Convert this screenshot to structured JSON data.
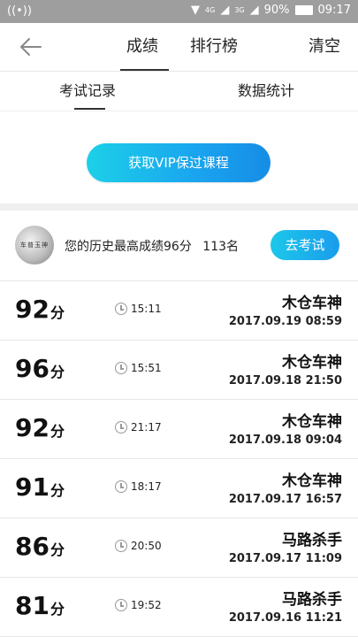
{
  "status_bar": {
    "network_4g": "4G",
    "network_3g": "3G",
    "battery": "90%",
    "time": "09:17"
  },
  "nav": {
    "tabs": [
      {
        "label": "成绩"
      },
      {
        "label": "排行榜"
      }
    ],
    "clear_label": "清空"
  },
  "subtabs": [
    {
      "label": "考试记录"
    },
    {
      "label": "数据统计"
    }
  ],
  "vip_button": "获取VIP保过课程",
  "history": {
    "best_text": "您的历史最高成绩96分",
    "rank_text": "113名",
    "exam_button": "去考试",
    "avatar_text": "车普玉神"
  },
  "records": [
    {
      "score": "92",
      "unit": "分",
      "duration": "15:11",
      "user": "木仓车神",
      "date": "2017.09.19  08:59"
    },
    {
      "score": "96",
      "unit": "分",
      "duration": "15:51",
      "user": "木仓车神",
      "date": "2017.09.18  21:50"
    },
    {
      "score": "92",
      "unit": "分",
      "duration": "21:17",
      "user": "木仓车神",
      "date": "2017.09.18  09:04"
    },
    {
      "score": "91",
      "unit": "分",
      "duration": "18:17",
      "user": "木仓车神",
      "date": "2017.09.17  16:57"
    },
    {
      "score": "86",
      "unit": "分",
      "duration": "20:50",
      "user": "马路杀手",
      "date": "2017.09.17  11:09"
    },
    {
      "score": "81",
      "unit": "分",
      "duration": "19:52",
      "user": "马路杀手",
      "date": "2017.09.16  11:21"
    }
  ]
}
